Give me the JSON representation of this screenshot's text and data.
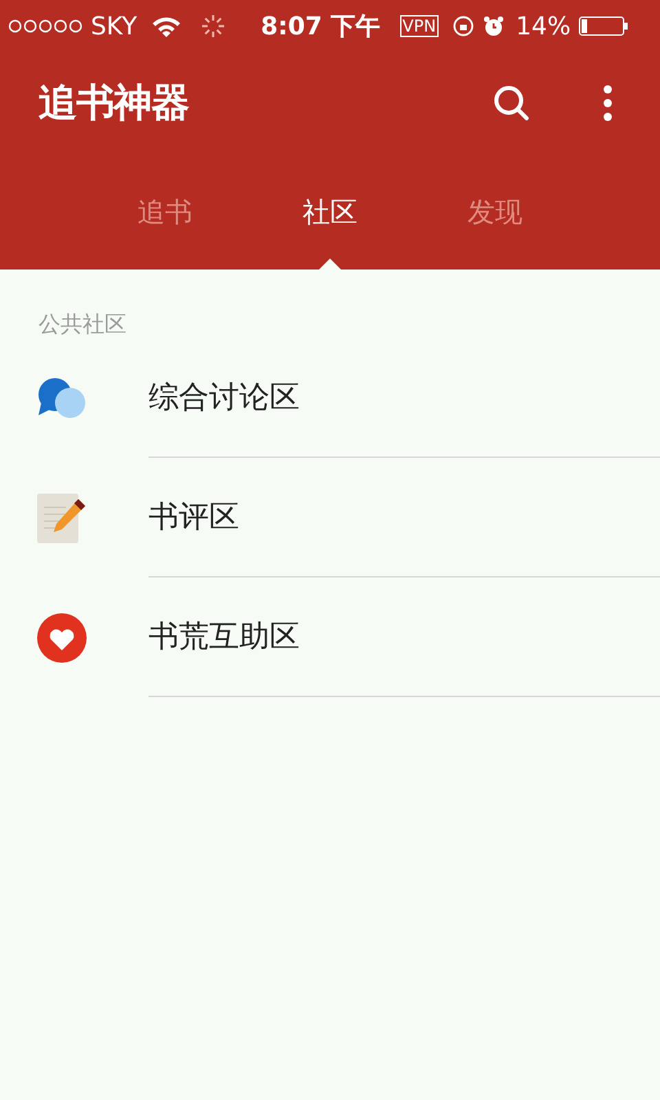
{
  "status_bar": {
    "carrier": "SKY",
    "time": "8:07 下午",
    "vpn": "VPN",
    "battery_text": "14%"
  },
  "app_bar": {
    "title": "追书神器"
  },
  "tabs": [
    {
      "label": "追书",
      "selected": false
    },
    {
      "label": "社区",
      "selected": true
    },
    {
      "label": "发现",
      "selected": false
    }
  ],
  "section": {
    "title": "公共社区"
  },
  "items": [
    {
      "label": "综合讨论区",
      "kind": "chat"
    },
    {
      "label": "书评区",
      "kind": "review"
    },
    {
      "label": "书荒互助区",
      "kind": "help"
    }
  ]
}
